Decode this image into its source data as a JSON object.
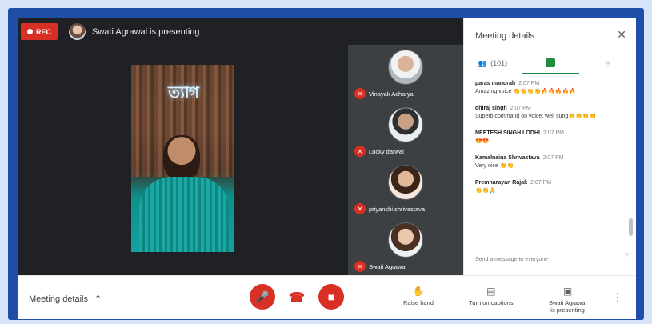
{
  "topbar": {
    "rec_label": "REC",
    "presenting_text": "Swati Agrawal is presenting"
  },
  "main_video": {
    "sign_text": "ত্যাগ"
  },
  "participants": [
    {
      "name": "Vinayak Acharya"
    },
    {
      "name": "Lucky darwal"
    },
    {
      "name": "priyanshi shrivastava"
    },
    {
      "name": "Swati Agrawal"
    }
  ],
  "panel": {
    "title": "Meeting details",
    "people_count": "(101)",
    "messages": [
      {
        "sender": "paras mandrah",
        "time": "2:07 PM",
        "text": "Amazing voice 👏👏👏👏🔥🔥🔥🔥🔥"
      },
      {
        "sender": "dhiraj singh",
        "time": "2:07 PM",
        "text": "Superb command on voice, well sung👏👏👏👏"
      },
      {
        "sender": "NEETESH SINGH LODHI",
        "time": "2:07 PM",
        "text": "😍😍"
      },
      {
        "sender": "Kamalnaina Shrivastava",
        "time": "2:07 PM",
        "text": "Very nice 👏👏"
      },
      {
        "sender": "Premnarayan Rajak",
        "time": "2:07 PM",
        "text": "👏👏🙏"
      }
    ],
    "send_placeholder": "Send a message to everyone"
  },
  "bottombar": {
    "meeting_details_label": "Meeting details",
    "raise_hand_label": "Raise hand",
    "captions_label": "Turn on captions",
    "presenting_label_line1": "Swati Agrawal",
    "presenting_label_line2": "is presenting"
  },
  "colors": {
    "accent_red": "#d93025",
    "accent_green": "#1e8e3e",
    "frame_blue": "#1f4fa8"
  }
}
